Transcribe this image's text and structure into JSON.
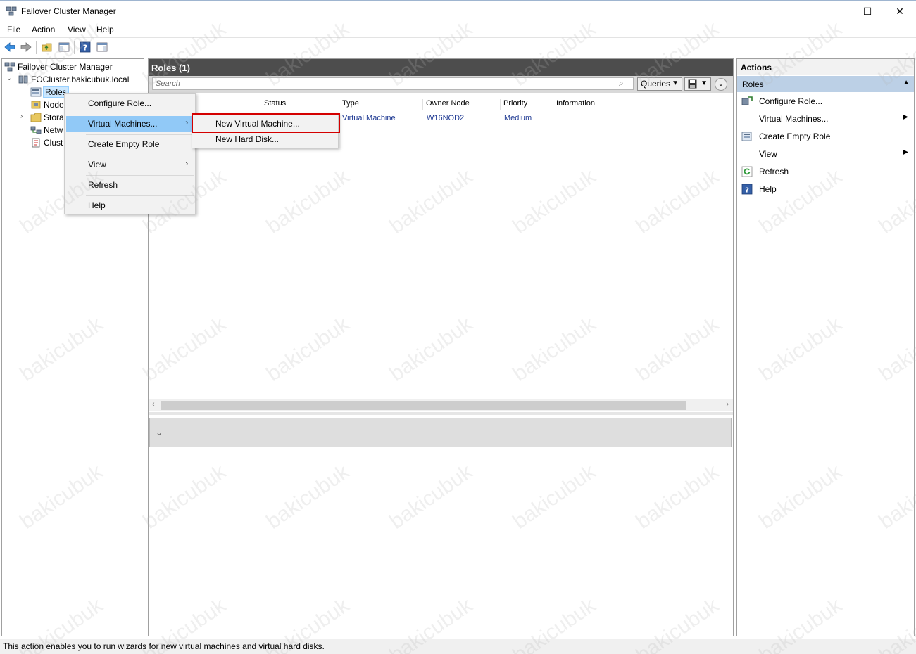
{
  "window": {
    "title": "Failover Cluster Manager",
    "minimize": "—",
    "maximize": "☐",
    "close": "✕"
  },
  "menubar": [
    "File",
    "Action",
    "View",
    "Help"
  ],
  "tree": {
    "root": "Failover Cluster Manager",
    "cluster": "FOCluster.bakicubuk.local",
    "items": [
      "Roles",
      "Node",
      "Stora",
      "Netw",
      "Clust"
    ]
  },
  "center": {
    "title": "Roles (1)",
    "search_placeholder": "Search",
    "queries_label": "Queries",
    "columns": [
      "Status",
      "Type",
      "Owner Node",
      "Priority",
      "Information"
    ],
    "rows": [
      {
        "type": "Virtual Machine",
        "owner": "W16NOD2",
        "priority": "Medium"
      }
    ]
  },
  "context_menu": {
    "items": [
      "Configure Role...",
      "Virtual Machines...",
      "Create Empty Role",
      "View",
      "Refresh",
      "Help"
    ],
    "submenu": [
      "New Virtual Machine...",
      "New Hard Disk..."
    ]
  },
  "actions": {
    "title": "Actions",
    "section": "Roles",
    "items": [
      "Configure Role...",
      "Virtual Machines...",
      "Create Empty Role",
      "View",
      "Refresh",
      "Help"
    ]
  },
  "statusbar": {
    "text": "This action enables you to run wizards for new virtual machines and virtual hard disks."
  },
  "watermark": "bakicubuk",
  "colors": {
    "menu_highlight": "#91c9f7",
    "annotation_red": "#d40000",
    "actions_section": "#bcd0e6",
    "panel_header": "#4d4d4d"
  }
}
